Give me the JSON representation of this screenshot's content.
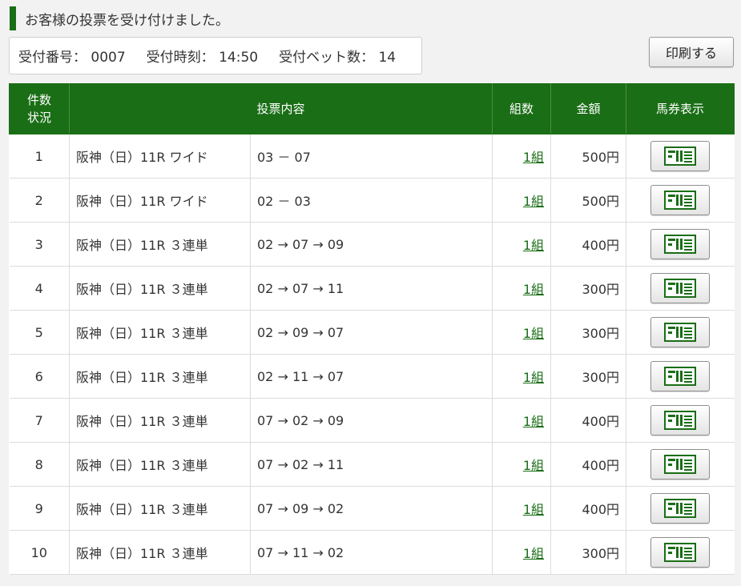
{
  "message": "お客様の投票を受け付けました。",
  "receipt": {
    "number_label": "受付番号：",
    "number": "0007",
    "time_label": "受付時刻：",
    "time": "14:50",
    "count_label": "受付ベット数：",
    "count": "14"
  },
  "print_button": "印刷する",
  "colors": {
    "accent": "#1a6e16",
    "link": "#1a6e16"
  },
  "table": {
    "headers": {
      "index_line1": "件数",
      "index_line2": "状況",
      "content": "投票内容",
      "kumi": "組数",
      "amount": "金額",
      "ticket": "馬券表示"
    },
    "rows": [
      {
        "num": "1",
        "race": "阪神（日）11R ワイド",
        "combo": "03 － 07",
        "kumi": "1組",
        "amount": "500円"
      },
      {
        "num": "2",
        "race": "阪神（日）11R ワイド",
        "combo": "02 － 03",
        "kumi": "1組",
        "amount": "500円"
      },
      {
        "num": "3",
        "race": "阪神（日）11R ３連単",
        "combo": "02 → 07 → 09",
        "kumi": "1組",
        "amount": "400円"
      },
      {
        "num": "4",
        "race": "阪神（日）11R ３連単",
        "combo": "02 → 07 → 11",
        "kumi": "1組",
        "amount": "300円"
      },
      {
        "num": "5",
        "race": "阪神（日）11R ３連単",
        "combo": "02 → 09 → 07",
        "kumi": "1組",
        "amount": "300円"
      },
      {
        "num": "6",
        "race": "阪神（日）11R ３連単",
        "combo": "02 → 11 → 07",
        "kumi": "1組",
        "amount": "300円"
      },
      {
        "num": "7",
        "race": "阪神（日）11R ３連単",
        "combo": "07 → 02 → 09",
        "kumi": "1組",
        "amount": "400円"
      },
      {
        "num": "8",
        "race": "阪神（日）11R ３連単",
        "combo": "07 → 02 → 11",
        "kumi": "1組",
        "amount": "400円"
      },
      {
        "num": "9",
        "race": "阪神（日）11R ３連単",
        "combo": "07 → 09 → 02",
        "kumi": "1組",
        "amount": "400円"
      },
      {
        "num": "10",
        "race": "阪神（日）11R ３連単",
        "combo": "07 → 11 → 02",
        "kumi": "1組",
        "amount": "300円"
      }
    ],
    "ticket_icon": "ticket-icon"
  }
}
